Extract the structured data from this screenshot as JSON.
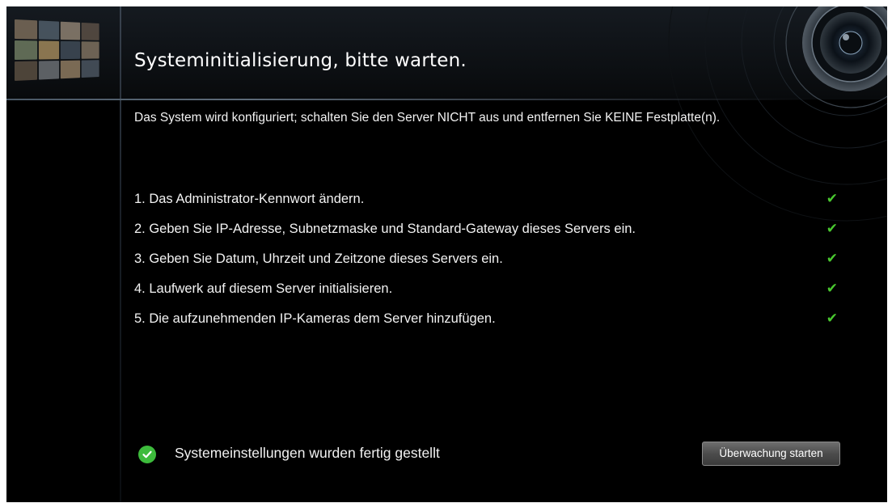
{
  "header": {
    "title": "Systeminitialisierung, bitte warten."
  },
  "notice": {
    "text": "Das System wird konfiguriert; schalten Sie den Server NICHT aus und entfernen Sie KEINE Festplatte(n)."
  },
  "steps": [
    {
      "label": "1. Das Administrator-Kennwort ändern.",
      "done": true,
      "check": "✔"
    },
    {
      "label": "2. Geben Sie IP-Adresse, Subnetzmaske und Standard-Gateway dieses Servers ein.",
      "done": true,
      "check": "✔"
    },
    {
      "label": "3. Geben Sie Datum, Uhrzeit und Zeitzone dieses Servers ein.",
      "done": true,
      "check": "✔"
    },
    {
      "label": "4. Laufwerk auf diesem Server initialisieren.",
      "done": true,
      "check": "✔"
    },
    {
      "label": "5. Die aufzunehmenden IP-Kameras dem Server hinzufügen.",
      "done": true,
      "check": "✔"
    }
  ],
  "status": {
    "text": "Systemeinstellungen wurden fertig gestellt",
    "icon": "check-circle-icon",
    "color": "#3dbb3c"
  },
  "actions": {
    "start_label": "Überwachung starten"
  },
  "colors": {
    "background": "#000000",
    "check_green": "#49c82f"
  },
  "icons": {
    "logo": "camera-thumbnails-logo",
    "decoration": "camera-lens-icon"
  }
}
